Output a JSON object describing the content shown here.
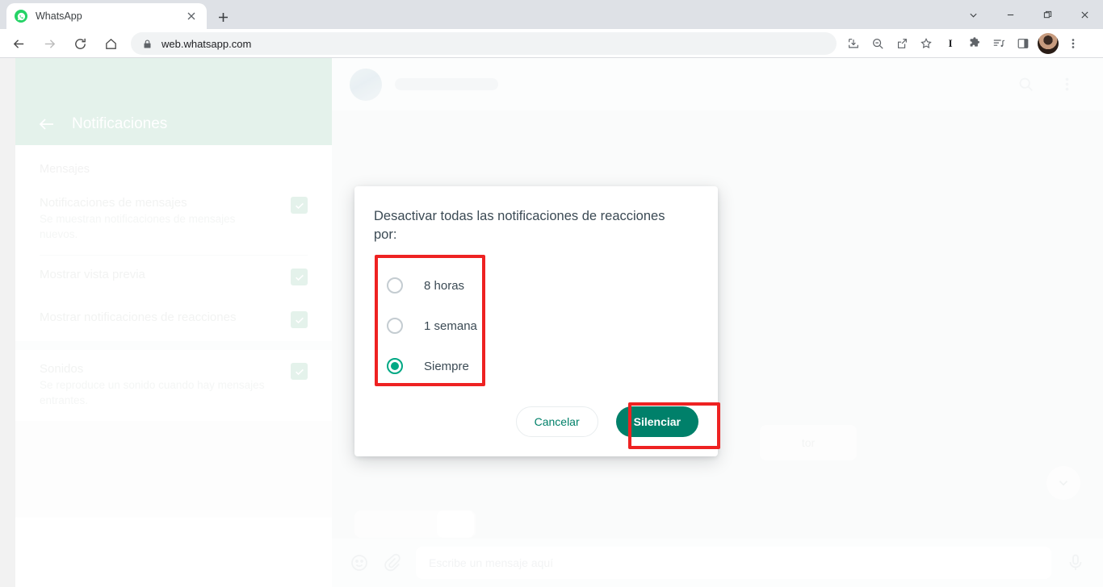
{
  "browser": {
    "tab": {
      "title": "WhatsApp",
      "favicon": "whatsapp-icon",
      "close": "×"
    },
    "new_tab_label": "+",
    "window_controls": [
      {
        "name": "chevron-down-icon"
      },
      {
        "name": "minimize-icon"
      },
      {
        "name": "maximize-icon"
      },
      {
        "name": "close-icon"
      }
    ],
    "nav": {
      "back": "back-arrow-icon",
      "forward": "forward-arrow-icon",
      "reload": "reload-icon",
      "home": "home-icon"
    },
    "omnibox": {
      "url": "web.whatsapp.com",
      "lock": "lock-icon"
    },
    "toolbar_icons": [
      "install-download-icon",
      "zoom-out-icon",
      "share-icon",
      "bookmark-star-icon",
      "italic-badge-icon",
      "extensions-puzzle-icon",
      "media-playlist-icon",
      "side-panel-icon"
    ],
    "profile_avatar": "avatar",
    "menu": "three-dot-menu-icon",
    "italic_badge": "I"
  },
  "settings": {
    "header": {
      "back": "back-arrow-icon",
      "title": "Notificaciones"
    },
    "section_label": "Mensajes",
    "rows": [
      {
        "name": "Notificaciones de mensajes",
        "desc": "Se muestran notificaciones de mensajes nuevos.",
        "checked": true
      },
      {
        "name": "Mostrar vista previa",
        "desc": "",
        "checked": true
      },
      {
        "name": "Mostrar notificaciones de reacciones",
        "desc": "",
        "checked": true
      },
      {
        "name": "Sonidos",
        "desc": "Se reproduce un sonido cuando hay mensajes entrantes.",
        "checked": true
      }
    ]
  },
  "chat": {
    "header_icons": [
      "search-icon",
      "three-dot-menu-icon"
    ],
    "message_fragment": "tor",
    "scroll_down_icon": "chevron-down-icon",
    "footer": {
      "emoji_icon": "emoji-icon",
      "attach_icon": "paperclip-icon",
      "placeholder": "Escribe un mensaje aquí",
      "mic_icon": "microphone-icon"
    }
  },
  "modal": {
    "title": "Desactivar todas las notificaciones de reacciones por:",
    "options": [
      {
        "label": "8 horas",
        "selected": false
      },
      {
        "label": "1 semana",
        "selected": false
      },
      {
        "label": "Siempre",
        "selected": true
      }
    ],
    "cancel_label": "Cancelar",
    "mute_label": "Silenciar"
  },
  "colors": {
    "accent_green": "#00a884",
    "button_green": "#00806a",
    "highlight_red": "#ee2222",
    "header_mint": "#d9ece3",
    "tabstrip": "#dee1e6"
  }
}
